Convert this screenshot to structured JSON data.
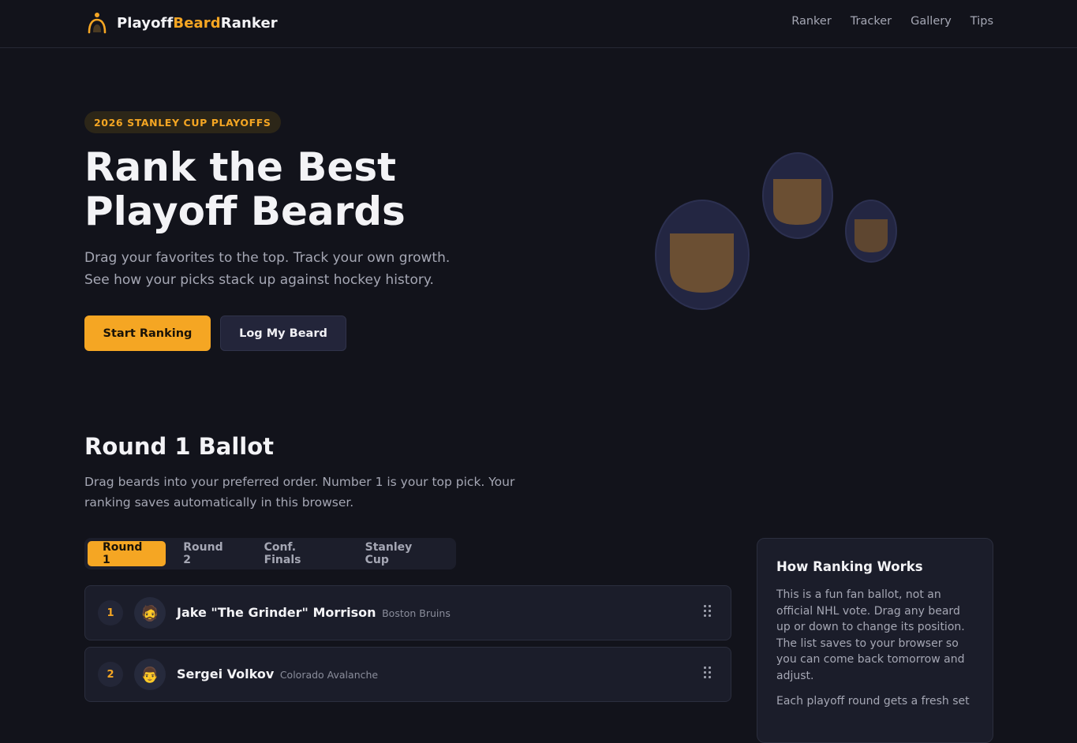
{
  "header": {
    "brand_a": "Playoff",
    "brand_b": "Beard",
    "brand_c": "Ranker",
    "nav": [
      "Ranker",
      "Tracker",
      "Gallery",
      "Tips"
    ]
  },
  "hero": {
    "badge": "2026 STANLEY CUP PLAYOFFS",
    "title_line1": "Rank the Best",
    "title_line2": "Playoff Beards",
    "sub_line1": "Drag your favorites to the top. Track your own growth.",
    "sub_line2": "See how your picks stack up against hockey history.",
    "primary_button": "Start Ranking",
    "secondary_button": "Log My Beard"
  },
  "ballot": {
    "title": "Round 1 Ballot",
    "description": "Drag beards into your preferred order. Number 1 is your top pick. Your ranking saves automatically in this browser.",
    "tabs": [
      "Round 1",
      "Round 2",
      "Conf. Finals",
      "Stanley Cup"
    ],
    "active_tab": "Round 1",
    "entries": [
      {
        "rank": "1",
        "avatar": "🧔",
        "name": "Jake \"The Grinder\" Morrison",
        "team": "Boston Bruins"
      },
      {
        "rank": "2",
        "avatar": "👨",
        "name": "Sergei Volkov",
        "team": "Colorado Avalanche"
      }
    ]
  },
  "info": {
    "title": "How Ranking Works",
    "p1": "This is a fun fan ballot, not an official NHL vote. Drag any beard up or down to change its position. The list saves to your browser so you can come back tomorrow and adjust.",
    "p2": "Each playoff round gets a fresh set"
  },
  "colors": {
    "background": "#12131b",
    "accent": "#f5a623",
    "card": "#1b1d2a",
    "muted_text": "#a5a7b4"
  }
}
